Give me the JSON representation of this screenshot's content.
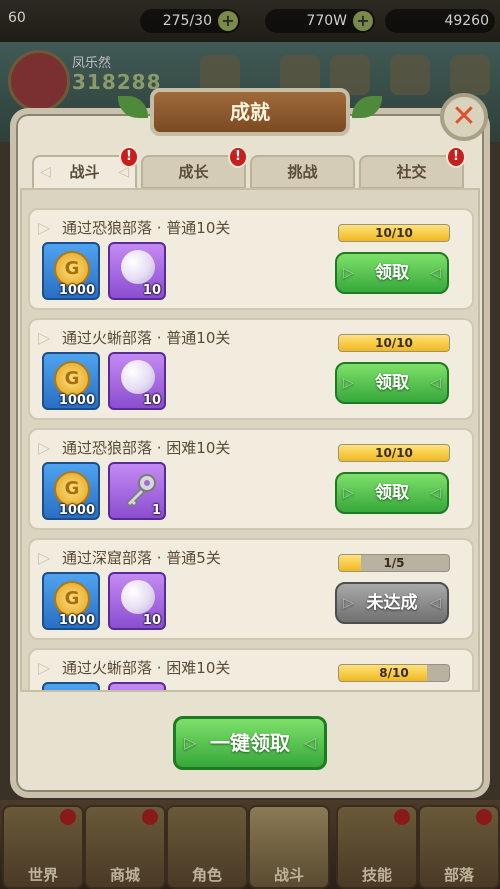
{
  "topbar": {
    "level": "60",
    "stamina": "275/30",
    "gold": "770W",
    "gems": "49260"
  },
  "player": {
    "name": "凤乐然",
    "power": "318288"
  },
  "bottom_nav": [
    {
      "label": "世界"
    },
    {
      "label": "商城"
    },
    {
      "label": "角色"
    },
    {
      "label": "战斗"
    },
    {
      "label": "技能"
    },
    {
      "label": "部落"
    }
  ],
  "dialog": {
    "title": "成就",
    "close_icon": "close-icon",
    "tabs": [
      {
        "label": "战斗",
        "active": true,
        "badge": "!"
      },
      {
        "label": "成长",
        "active": false,
        "badge": "!"
      },
      {
        "label": "挑战",
        "active": false,
        "badge": ""
      },
      {
        "label": "社交",
        "active": false,
        "badge": "!"
      }
    ],
    "achievements": [
      {
        "title": "通过恐狼部落 · 普通10关",
        "rewards": [
          {
            "icon": "gold-coin-icon",
            "qty": "1000"
          },
          {
            "icon": "pearl-orb-icon",
            "qty": "10"
          }
        ],
        "progress": "10/10",
        "progress_value": 1.0,
        "button": "领取",
        "state": "claimable"
      },
      {
        "title": "通过火蜥部落 · 普通10关",
        "rewards": [
          {
            "icon": "gold-coin-icon",
            "qty": "1000"
          },
          {
            "icon": "pearl-orb-icon",
            "qty": "10"
          }
        ],
        "progress": "10/10",
        "progress_value": 1.0,
        "button": "领取",
        "state": "claimable"
      },
      {
        "title": "通过恐狼部落 · 困难10关",
        "rewards": [
          {
            "icon": "gold-coin-icon",
            "qty": "1000"
          },
          {
            "icon": "key-icon",
            "qty": "1"
          }
        ],
        "progress": "10/10",
        "progress_value": 1.0,
        "button": "领取",
        "state": "claimable"
      },
      {
        "title": "通过深窟部落 · 普通5关",
        "rewards": [
          {
            "icon": "gold-coin-icon",
            "qty": "1000"
          },
          {
            "icon": "pearl-orb-icon",
            "qty": "10"
          }
        ],
        "progress": "1/5",
        "progress_value": 0.2,
        "button": "未达成",
        "state": "incomplete"
      },
      {
        "title": "通过火蜥部落 · 困难10关",
        "rewards": [
          {
            "icon": "gold-coin-icon",
            "qty": ""
          },
          {
            "icon": "pearl-orb-icon",
            "qty": ""
          }
        ],
        "progress": "8/10",
        "progress_value": 0.8,
        "button": "",
        "state": "partial-visible"
      }
    ],
    "claim_all_label": "一键领取"
  },
  "colors": {
    "claim_green": "#36a83a",
    "disabled_gray": "#707070",
    "progress_gold": "#f0b820",
    "badge_red": "#c81e1e"
  }
}
